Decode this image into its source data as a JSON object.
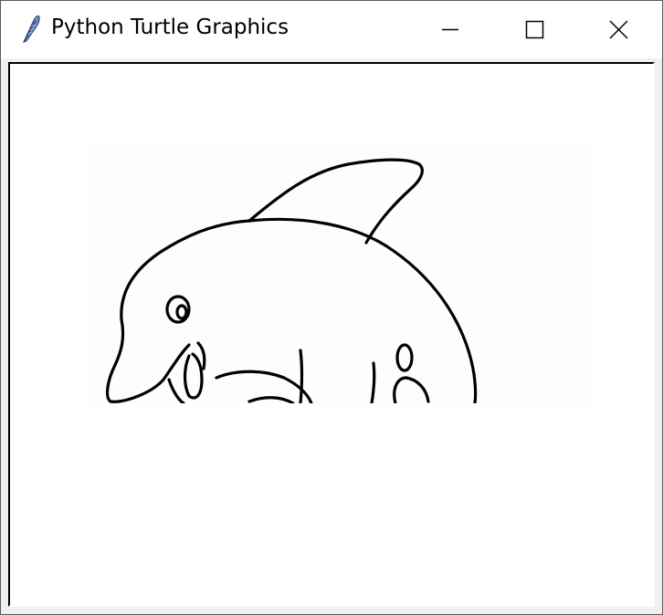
{
  "window": {
    "title": "Python Turtle Graphics",
    "app_icon": "feather-icon",
    "controls": {
      "minimize": "minimize-icon",
      "maximize": "maximize-icon",
      "close": "close-icon"
    }
  },
  "canvas": {
    "background": "#ffffff",
    "stroke_color": "#000000",
    "drawing_subject": "dolphin-outline"
  }
}
